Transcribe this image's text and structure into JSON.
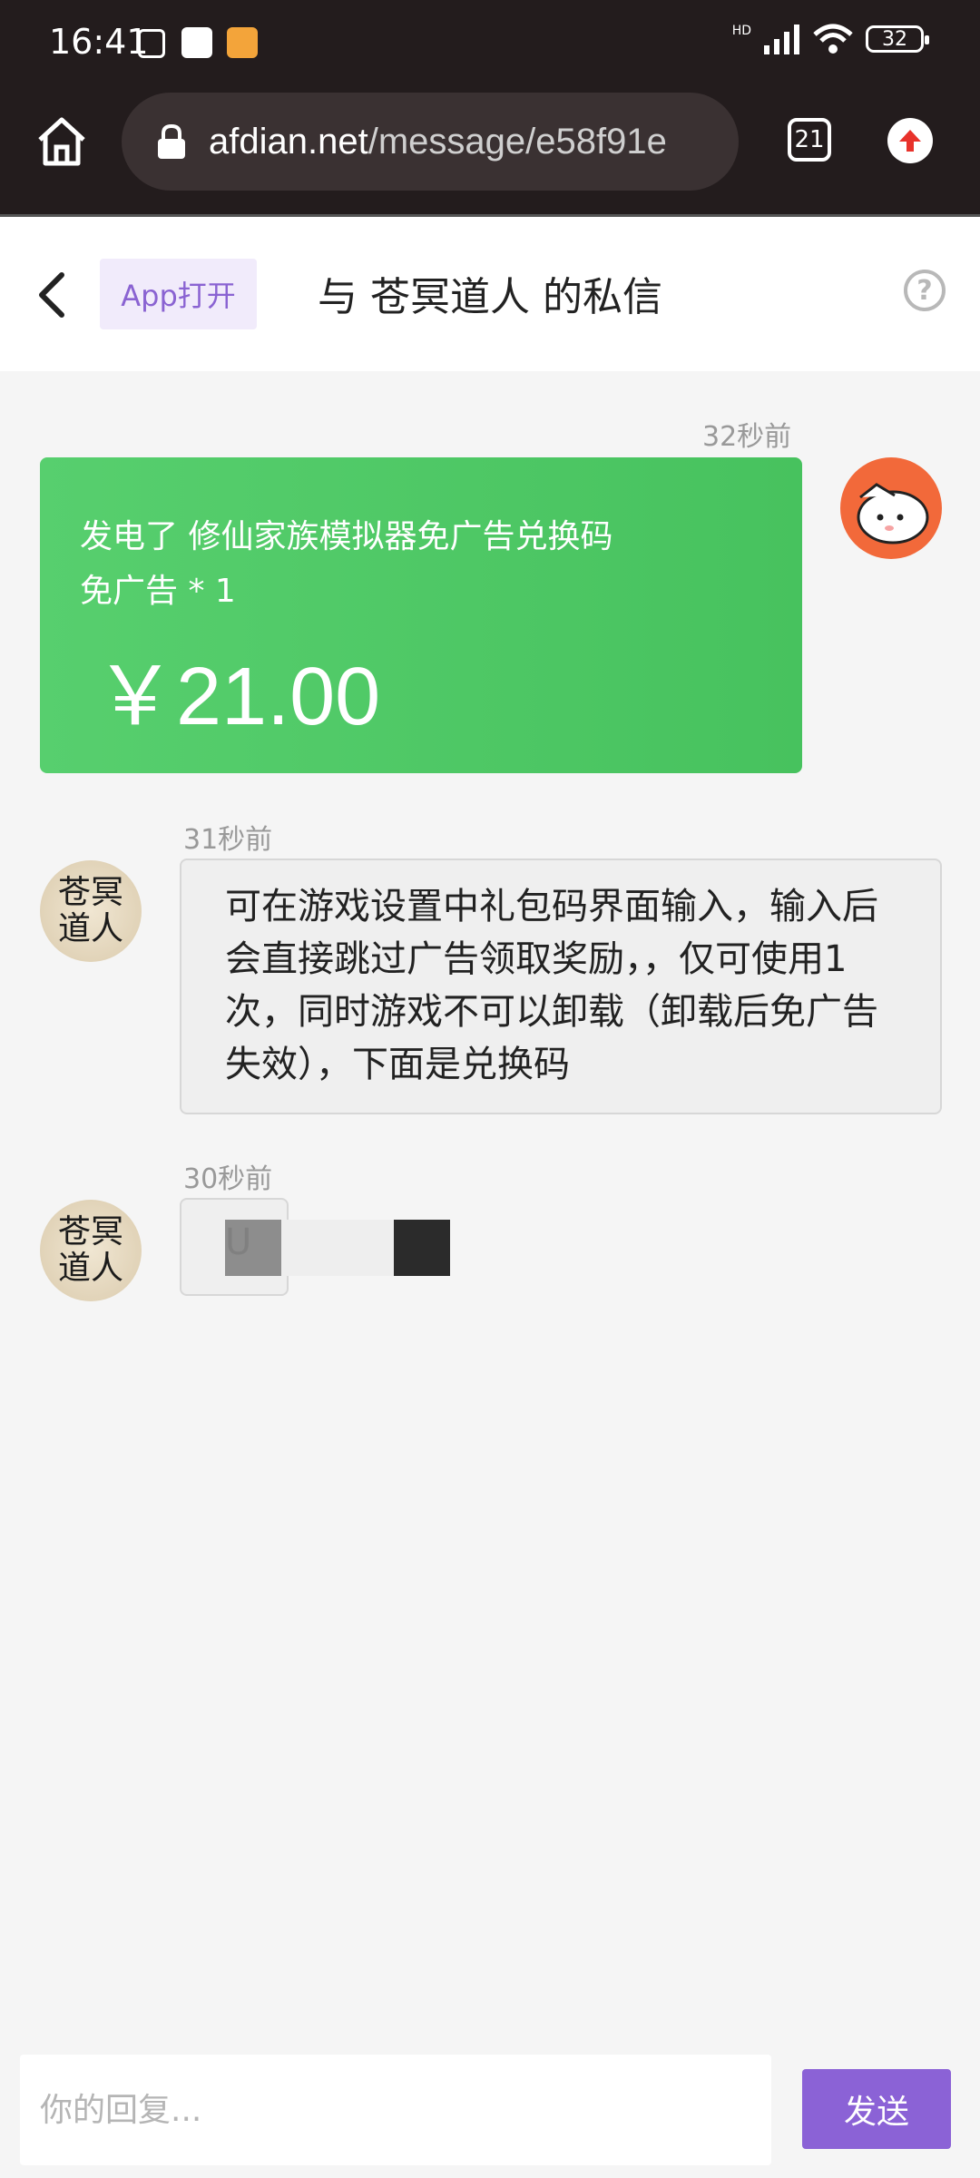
{
  "status_bar": {
    "time": "16:41",
    "battery": "32",
    "network": "HD"
  },
  "browser": {
    "url_domain": "afdian.net",
    "url_path": "/message/e58f91e",
    "tab_count": "21"
  },
  "header": {
    "app_open_label": "App打开",
    "title": "与 苍冥道人 的私信",
    "help_symbol": "?"
  },
  "messages": [
    {
      "time": "32秒前",
      "line1": "发电了 修仙家族模拟器免广告兑换码",
      "line2": "免广告 * 1",
      "amount": "￥21.00"
    },
    {
      "time": "31秒前",
      "avatar_text": "苍冥道人",
      "text": "可在游戏设置中礼包码界面输入，输入后会直接跳过广告领取奖励，，仅可使用1次，同时游戏不可以卸载（卸载后免广告失效），下面是兑换码"
    },
    {
      "time": "30秒前",
      "avatar_text": "苍冥道人",
      "text": "U"
    }
  ],
  "composer": {
    "placeholder": "你的回复...",
    "send_label": "发送"
  },
  "colors": {
    "accent": "#8b62d6",
    "payment_green": "#4cc763",
    "my_avatar": "#f2693a"
  }
}
